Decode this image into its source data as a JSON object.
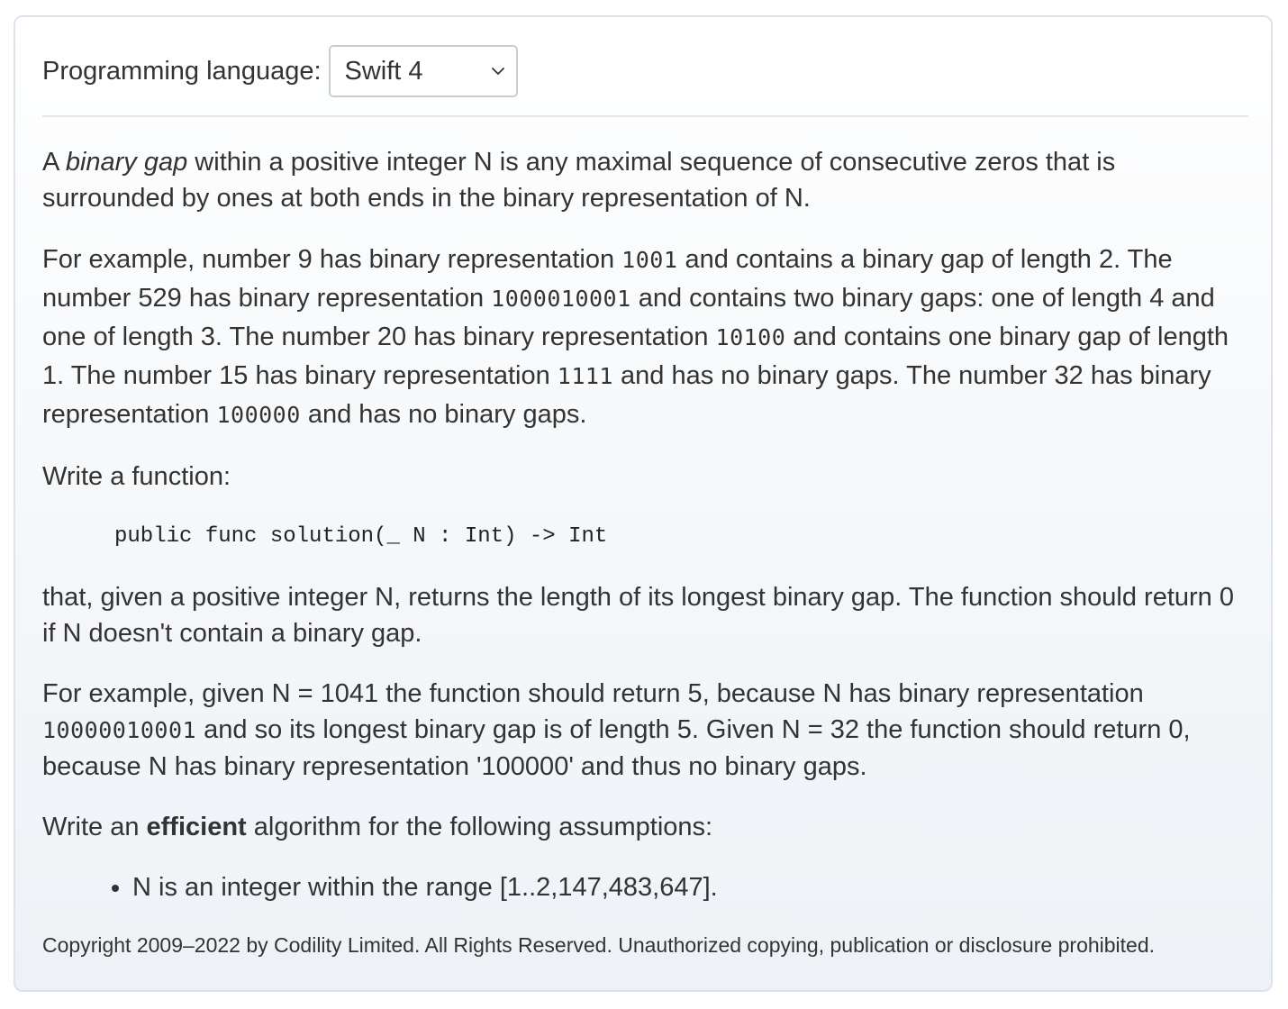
{
  "language_selector": {
    "label": "Programming language:",
    "selected": "Swift 4"
  },
  "task": {
    "p1": {
      "a": "A ",
      "em": "binary gap",
      "b": " within a positive integer N is any maximal sequence of consecutive zeros that is surrounded by ones at both ends in the binary representation of N."
    },
    "p2": {
      "t1": "For example, number 9 has binary representation ",
      "c1": "1001",
      "t2": " and contains a binary gap of length 2. The number 529 has binary representation ",
      "c2": "1000010001",
      "t3": " and contains two binary gaps: one of length 4 and one of length 3. The number 20 has binary representation ",
      "c3": "10100",
      "t4": " and contains one binary gap of length 1. The number 15 has binary representation ",
      "c4": "1111",
      "t5": " and has no binary gaps. The number 32 has binary representation ",
      "c5": "100000",
      "t6": " and has no binary gaps."
    },
    "p3": "Write a function:",
    "signature": "public func solution(_ N : Int) -> Int",
    "p4": "that, given a positive integer N, returns the length of its longest binary gap. The function should return 0 if N doesn't contain a binary gap.",
    "p5": {
      "t1": "For example, given N = 1041 the function should return 5, because N has binary representation ",
      "c1": "10000010001",
      "t2": " and so its longest binary gap is of length 5. Given N = 32 the function should return 0, because N has binary representation '100000' and thus no binary gaps."
    },
    "p6": {
      "a": "Write an ",
      "strong": "efficient",
      "b": " algorithm for the following assumptions:"
    },
    "assumptions": [
      "N is an integer within the range [1..2,147,483,647]."
    ]
  },
  "copyright": "Copyright 2009–2022 by Codility Limited. All Rights Reserved. Unauthorized copying, publication or disclosure prohibited.",
  "icons": {
    "dropdown": "chevron-down-icon"
  }
}
